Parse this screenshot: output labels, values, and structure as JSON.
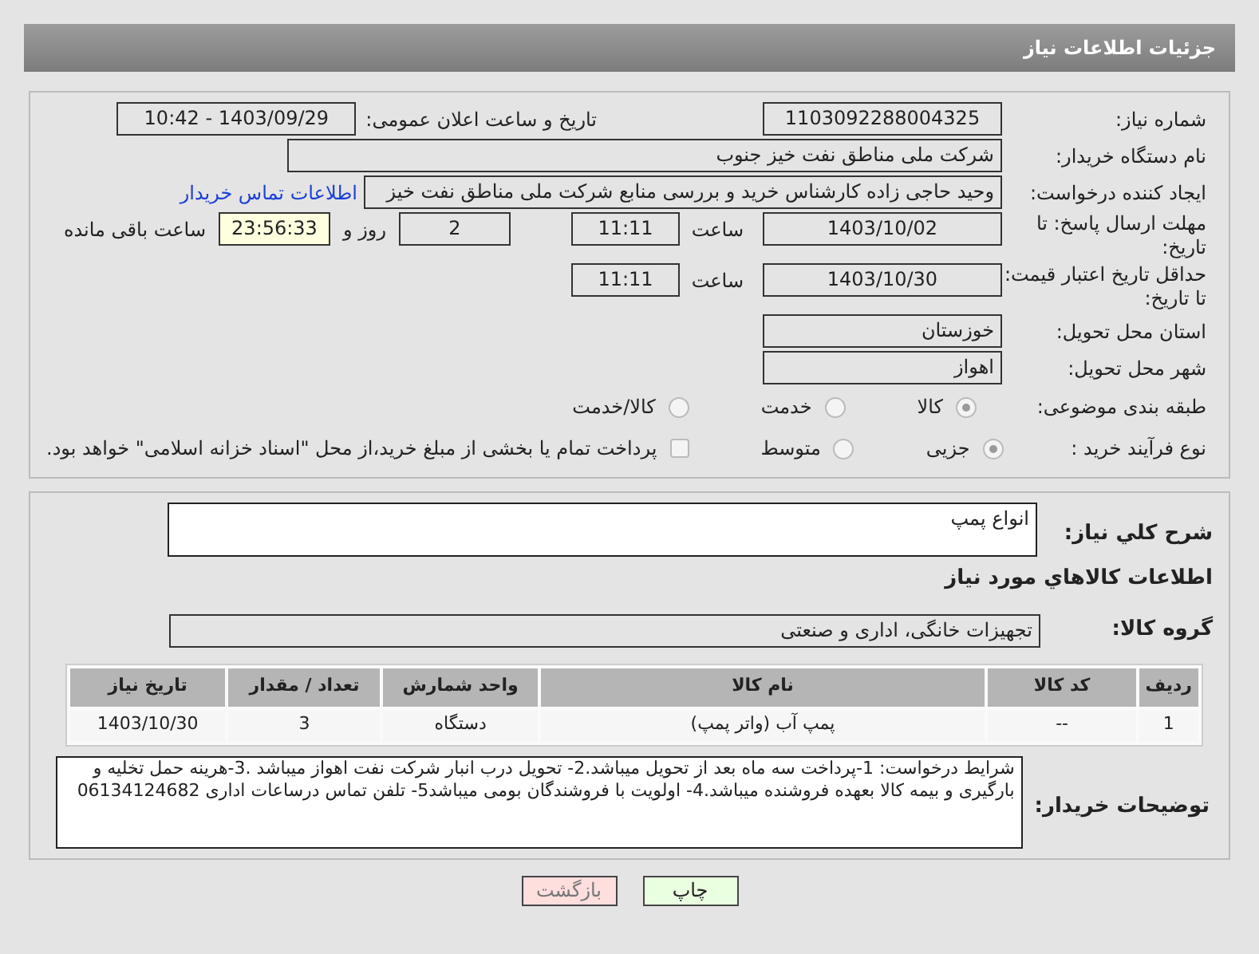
{
  "header": {
    "title": "جزئیات اطلاعات نیاز"
  },
  "form": {
    "need_number": {
      "label": "شماره نیاز:",
      "value": "1103092288004325"
    },
    "announce": {
      "label": "تاریخ و ساعت اعلان عمومی:",
      "value": "1403/09/29 - 10:42"
    },
    "buyer": {
      "label": "نام دستگاه خریدار:",
      "value": "شرکت ملی مناطق نفت خیز جنوب"
    },
    "creator": {
      "label": "ایجاد کننده درخواست:",
      "value": "وحید حاجی زاده  کارشناس خرید و بررسی منابع  شرکت ملی مناطق نفت خیز",
      "link": "اطلاعات تماس خریدار"
    },
    "deadline": {
      "label": "مهلت ارسال پاسخ: تا تاریخ:",
      "date": "1403/10/02",
      "time_label": "ساعت",
      "time": "11:11",
      "days": "2",
      "days_label": "روز و",
      "remaining": "23:56:33",
      "remaining_label": "ساعت باقی مانده"
    },
    "validity": {
      "label": "حداقل تاریخ اعتبار قیمت: تا تاریخ:",
      "date": "1403/10/30",
      "time_label": "ساعت",
      "time": "11:11"
    },
    "province": {
      "label": "استان محل تحویل:",
      "value": "خوزستان"
    },
    "city": {
      "label": "شهر محل تحویل:",
      "value": "اهواز"
    },
    "category": {
      "label": "طبقه بندی موضوعی:",
      "options": [
        {
          "label": "کالا",
          "selected": true
        },
        {
          "label": "خدمت",
          "selected": false
        },
        {
          "label": "کالا/خدمت",
          "selected": false
        }
      ]
    },
    "process": {
      "label": "نوع فرآیند خرید :",
      "options": [
        {
          "label": "جزیی",
          "selected": true
        },
        {
          "label": "متوسط",
          "selected": false
        }
      ],
      "treasury": {
        "label": "پرداخت تمام یا بخشی از مبلغ خرید،از محل \"اسناد خزانه اسلامی\" خواهد بود.",
        "checked": false
      }
    }
  },
  "details": {
    "description": {
      "label": "شرح کلي نياز:",
      "value": "انواع پمپ"
    },
    "goods_heading": "اطلاعات کالاهاي مورد نياز",
    "group": {
      "label": "گروه کالا:",
      "value": "تجهیزات خانگی، اداری و صنعتی"
    },
    "table": {
      "columns": [
        "ردیف",
        "کد کالا",
        "نام کالا",
        "واحد شمارش",
        "تعداد / مقدار",
        "تاریخ نیاز"
      ],
      "rows": [
        [
          "1",
          "--",
          "پمپ آب (واتر پمپ)",
          "دستگاه",
          "3",
          "1403/10/30"
        ]
      ]
    },
    "notes": {
      "label": "توضیحات خریدار:",
      "value": "شرایط درخواست: 1-پرداخت سه ماه بعد از تحویل میباشد.2- تحویل درب انبار شرکت نفت اهواز میباشد .3-هرینه حمل تخلیه و بارگیری و بیمه کالا بعهده فروشنده میباشد.4-   اولویت با فروشندگان بومی میباشد5- تلفن تماس درساعات اداری 06134124682"
    }
  },
  "buttons": [
    {
      "label": "چاپ",
      "kind": "print"
    },
    {
      "label": "بازگشت",
      "kind": "back"
    }
  ]
}
